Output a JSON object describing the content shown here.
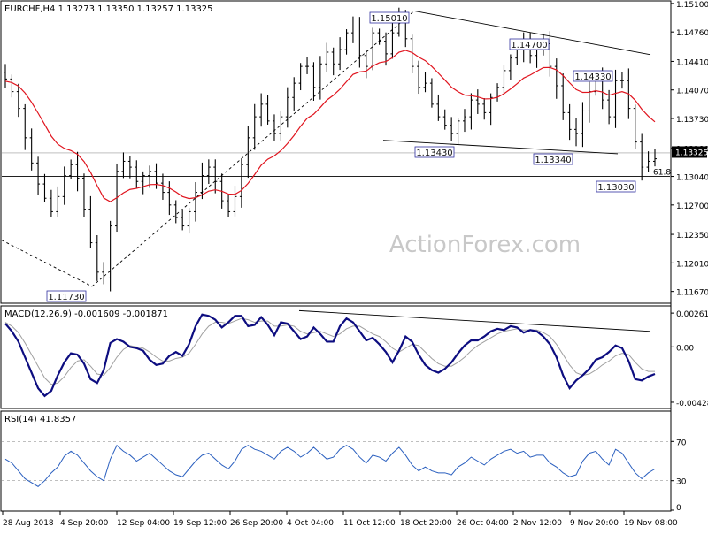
{
  "header": {
    "main_info": "EURCHF,H4  1.13273 1.13350 1.13257 1.13325",
    "macd_info": "MACD(12,26,9) -0.001609 -0.001871",
    "rsi_info": "RSI(14) 41.8357"
  },
  "watermark": "ActionForex.com",
  "colors": {
    "price": "#000000",
    "ema": "#e0141e",
    "macd_line": "#0d0d80",
    "macd_signal": "#a0a0a0",
    "rsi": "#2a5fbf",
    "label_border": "#3030a0",
    "current_price_bg": "#000000"
  },
  "chart_data": [
    {
      "type": "line",
      "title": "EURCHF,H4",
      "ylim": [
        1.1154,
        1.1512
      ],
      "y_ticks": [
        "1.15100",
        "1.14760",
        "1.14410",
        "1.14070",
        "1.13730",
        "1.13380",
        "1.13040",
        "1.12700",
        "1.12350",
        "1.12010",
        "1.11670"
      ],
      "x_ticks": [
        "28 Aug 2018",
        "4 Sep 20:00",
        "12 Sep 04:00",
        "19 Sep 12:00",
        "26 Sep 20:00",
        "4 Oct 04:00",
        "11 Oct 12:00",
        "18 Oct 20:00",
        "26 Oct 04:00",
        "2 Nov 12:00",
        "9 Nov 20:00",
        "19 Nov 08:00"
      ],
      "series": [
        {
          "type": "candles",
          "values": [
            1.142,
            1.1405,
            1.1385,
            1.135,
            1.132,
            1.1295,
            1.1278,
            1.1262,
            1.128,
            1.1305,
            1.1318,
            1.1302,
            1.1265,
            1.1225,
            1.119,
            1.1183,
            1.1245,
            1.131,
            1.1322,
            1.1315,
            1.1298,
            1.1305,
            1.131,
            1.1296,
            1.1285,
            1.127,
            1.1255,
            1.1245,
            1.1262,
            1.1285,
            1.1305,
            1.1315,
            1.1298,
            1.1275,
            1.1262,
            1.128,
            1.1318,
            1.135,
            1.1375,
            1.139,
            1.137,
            1.1355,
            1.1375,
            1.1398,
            1.1415,
            1.1435,
            1.1435,
            1.141,
            1.1438,
            1.1452,
            1.1438,
            1.1455,
            1.1475,
            1.1482,
            1.1448,
            1.1435,
            1.1475,
            1.1465,
            1.145,
            1.1475,
            1.1495,
            1.1468,
            1.1435,
            1.141,
            1.1415,
            1.139,
            1.1375,
            1.1365,
            1.1355,
            1.137,
            1.1375,
            1.1395,
            1.139,
            1.138,
            1.1398,
            1.141,
            1.143,
            1.1445,
            1.1455,
            1.1465,
            1.1448,
            1.1458,
            1.1462,
            1.1435,
            1.1412,
            1.138,
            1.136,
            1.1355,
            1.1382,
            1.1405,
            1.1418,
            1.1395,
            1.1375,
            1.1418,
            1.1418,
            1.1385,
            1.1345,
            1.1315,
            1.1322,
            1.1325
          ]
        },
        {
          "name": "",
          "type": "ema"
        }
      ],
      "current_price": "1.13325",
      "annotations": [
        {
          "text": "1.15010",
          "x": "18 Oct",
          "y": 1.1501
        },
        {
          "text": "1.14700",
          "x": "4 Nov",
          "y": 1.147
        },
        {
          "text": "1.14330",
          "x": "13 Nov",
          "y": 1.1433
        },
        {
          "text": "1.13430",
          "x": "24 Oct",
          "y": 1.1343
        },
        {
          "text": "1.13340",
          "x": "8 Nov",
          "y": 1.1334
        },
        {
          "text": "1.13030",
          "x": "19 Nov",
          "y": 1.1303
        },
        {
          "text": "1.11730",
          "x": "6 Sep",
          "y": 1.1173
        },
        {
          "text": "61.8",
          "y": 1.1304
        }
      ],
      "trendlines": [
        {
          "from": [
            "18 Oct",
            1.1501
          ],
          "to": [
            "22 Nov",
            1.1449
          ]
        },
        {
          "from": [
            "22 Oct",
            1.1347
          ],
          "to": [
            "16 Nov",
            1.1331
          ]
        },
        {
          "from": [
            "28 Aug",
            1.1228
          ],
          "to": [
            "6 Sep",
            1.1173
          ]
        },
        {
          "from": [
            "6 Sep",
            1.1173
          ],
          "to": [
            "18 Oct",
            1.1501
          ]
        }
      ],
      "horizontal_levels": [
        1.1304,
        1.1332
      ]
    },
    {
      "type": "line",
      "title": "MACD(12,26,9)",
      "ylim": [
        -0.0047,
        0.0031
      ],
      "y_ticks": [
        "0.002613",
        "0.00",
        "-0.004287"
      ],
      "series": [
        {
          "name": "MACD",
          "values": [
            0.0018,
            0.0012,
            0.0004,
            -0.0008,
            -0.002,
            -0.0032,
            -0.0038,
            -0.0034,
            -0.0022,
            -0.0012,
            -0.0005,
            -0.0006,
            -0.0013,
            -0.0025,
            -0.0028,
            -0.0018,
            0.0003,
            0.0006,
            0.0004,
            0.0,
            -0.0001,
            -0.0003,
            -0.001,
            -0.0014,
            -0.0013,
            -0.0007,
            -0.0004,
            -0.0007,
            0.0002,
            0.0016,
            0.0025,
            0.0024,
            0.0021,
            0.0015,
            0.0019,
            0.0024,
            0.0024,
            0.0016,
            0.0017,
            0.0023,
            0.0017,
            0.0009,
            0.0019,
            0.0018,
            0.0012,
            0.0006,
            0.0008,
            0.0015,
            0.001,
            0.0004,
            0.0004,
            0.0016,
            0.0022,
            0.0019,
            0.0012,
            0.0005,
            0.0007,
            0.0002,
            -0.0004,
            -0.0012,
            -0.0003,
            0.0008,
            0.0004,
            -0.0006,
            -0.0014,
            -0.0018,
            -0.002,
            -0.0017,
            -0.0012,
            -0.0005,
            0.0001,
            0.0005,
            0.0005,
            0.0008,
            0.0012,
            0.0014,
            0.0013,
            0.0016,
            0.0015,
            0.0011,
            0.0013,
            0.0012,
            0.0008,
            0.0002,
            -0.0008,
            -0.0022,
            -0.0032,
            -0.0026,
            -0.0022,
            -0.0017,
            -0.001,
            -0.0008,
            -0.0004,
            0.0001,
            -0.0001,
            -0.0011,
            -0.0025,
            -0.0026,
            -0.0023,
            -0.0021
          ]
        },
        {
          "name": "Signal",
          "values": [
            0.0019,
            0.0016,
            0.0011,
            0.0003,
            -0.0006,
            -0.0015,
            -0.0024,
            -0.0029,
            -0.0028,
            -0.0023,
            -0.0016,
            -0.0011,
            -0.001,
            -0.0015,
            -0.0021,
            -0.0022,
            -0.0016,
            -0.0008,
            -0.0002,
            0.0001,
            0.0,
            -0.0001,
            -0.0004,
            -0.0008,
            -0.0011,
            -0.0011,
            -0.0009,
            -0.0008,
            -0.0005,
            0.0002,
            0.001,
            0.0016,
            0.0019,
            0.0019,
            0.0018,
            0.002,
            0.0022,
            0.0021,
            0.0019,
            0.002,
            0.002,
            0.0016,
            0.0016,
            0.0017,
            0.0016,
            0.0012,
            0.001,
            0.0011,
            0.0012,
            0.001,
            0.0008,
            0.001,
            0.0014,
            0.0016,
            0.0016,
            0.0013,
            0.001,
            0.0008,
            0.0004,
            -0.0001,
            -0.0004,
            -0.0001,
            0.0002,
            0.0001,
            -0.0004,
            -0.0009,
            -0.0013,
            -0.0015,
            -0.0015,
            -0.0012,
            -0.0008,
            -0.0003,
            0.0001,
            0.0004,
            0.0007,
            0.001,
            0.0012,
            0.0013,
            0.0014,
            0.0013,
            0.0013,
            0.0013,
            0.0011,
            0.0008,
            0.0002,
            -0.0006,
            -0.0014,
            -0.002,
            -0.0022,
            -0.0021,
            -0.0018,
            -0.0014,
            -0.0011,
            -0.0007,
            -0.0005,
            -0.0006,
            -0.0012,
            -0.0017,
            -0.0019,
            -0.0019
          ]
        }
      ],
      "trendlines": [
        {
          "from": [
            "8 Oct",
            0.0028
          ],
          "to": [
            "22 Nov",
            0.0012
          ]
        }
      ]
    },
    {
      "type": "line",
      "title": "RSI(14)",
      "ylim": [
        0,
        100
      ],
      "y_ticks": [
        "70",
        "30",
        "0"
      ],
      "levels": [
        70,
        30
      ],
      "series": [
        {
          "name": "RSI",
          "values": [
            52,
            48,
            40,
            32,
            28,
            24,
            30,
            38,
            44,
            55,
            60,
            56,
            48,
            40,
            34,
            30,
            52,
            66,
            60,
            56,
            50,
            54,
            58,
            52,
            46,
            40,
            36,
            34,
            42,
            50,
            56,
            58,
            52,
            46,
            42,
            50,
            62,
            66,
            62,
            60,
            56,
            52,
            60,
            64,
            60,
            54,
            58,
            64,
            58,
            52,
            54,
            62,
            66,
            62,
            54,
            48,
            56,
            54,
            50,
            58,
            64,
            56,
            46,
            40,
            44,
            40,
            38,
            38,
            36,
            44,
            48,
            54,
            50,
            46,
            52,
            56,
            60,
            62,
            58,
            60,
            54,
            56,
            56,
            48,
            44,
            38,
            34,
            36,
            50,
            58,
            60,
            52,
            46,
            62,
            58,
            48,
            38,
            32,
            38,
            42
          ]
        }
      ]
    }
  ]
}
